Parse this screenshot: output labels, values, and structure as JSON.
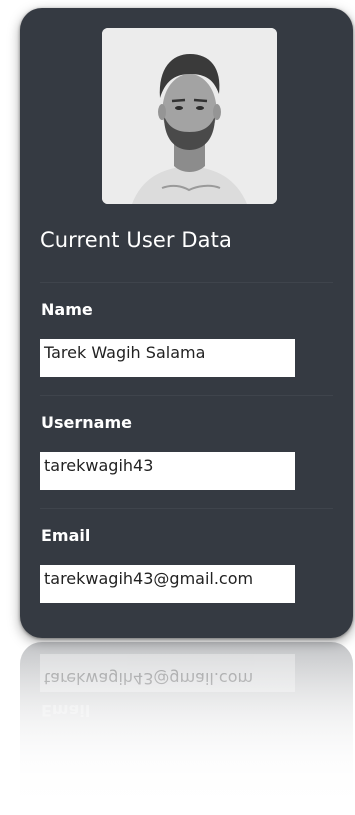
{
  "profile": {
    "title": "Current User Data",
    "photo_icon": "user-photo"
  },
  "fields": {
    "name": {
      "label": "Name",
      "value": "Tarek Wagih Salama"
    },
    "username": {
      "label": "Username",
      "value": "tarekwagih43"
    },
    "email": {
      "label": "Email",
      "value": "tarekwagih43@gmail.com"
    }
  },
  "colors": {
    "card_background": "#353a42",
    "input_background": "#ffffff",
    "text": "#ffffff"
  }
}
